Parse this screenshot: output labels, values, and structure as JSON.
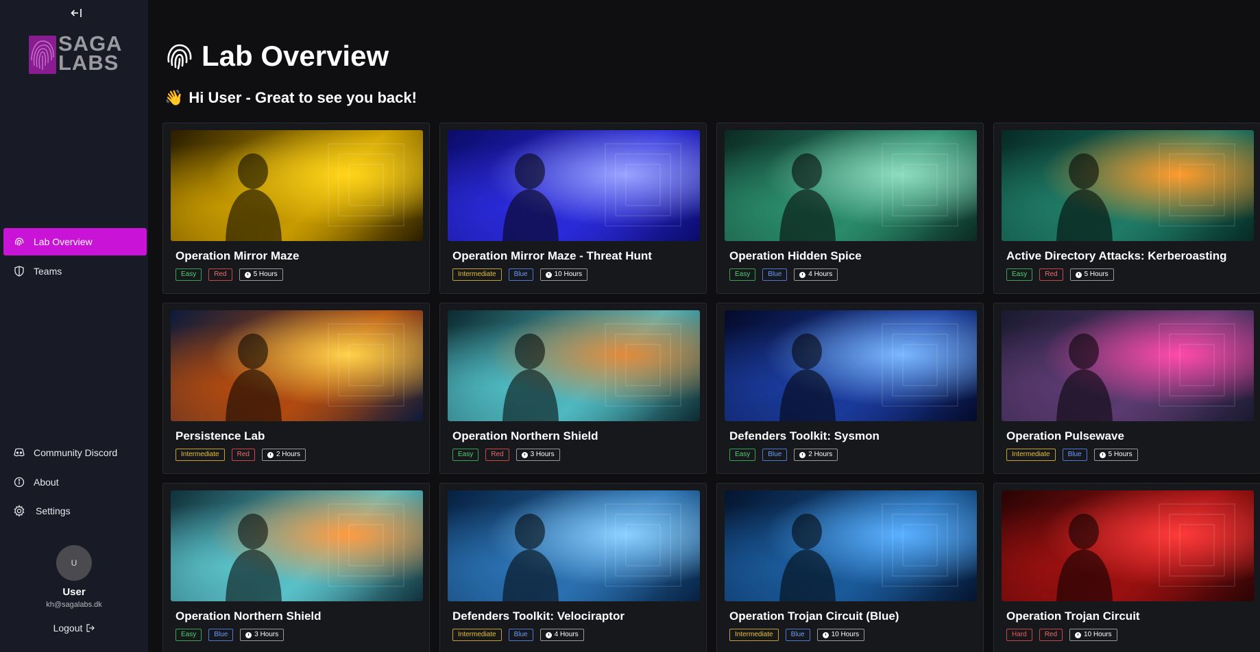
{
  "sidebar": {
    "logo_text_line1": "SAGA",
    "logo_text_line2": "LABS",
    "nav": [
      {
        "label": "Lab Overview",
        "icon": "fingerprint-icon",
        "active": true
      },
      {
        "label": "Teams",
        "icon": "shield-icon",
        "active": false
      }
    ],
    "bottom_nav": [
      {
        "label": "Community Discord",
        "icon": "discord-icon"
      },
      {
        "label": "About",
        "icon": "info-icon"
      },
      {
        "label": "Settings",
        "icon": "gear-icon"
      }
    ],
    "user": {
      "initial": "U",
      "name": "User",
      "email": "kh@sagalabs.dk",
      "logout_label": "Logout"
    }
  },
  "main": {
    "title": "Lab Overview",
    "greeting_emoji": "👋",
    "greeting": "Hi User - Great to see you back!"
  },
  "labs": [
    {
      "title": "Operation Mirror Maze",
      "difficulty": "Easy",
      "team": "Red",
      "duration": "5 Hours",
      "palette": [
        "#2a1d00",
        "#c79a00",
        "#ffd51a"
      ]
    },
    {
      "title": "Operation Mirror Maze - Threat Hunt",
      "difficulty": "Intermediate",
      "team": "Blue",
      "duration": "10 Hours",
      "palette": [
        "#0b0b6a",
        "#2a2ad8",
        "#9aa4ff"
      ]
    },
    {
      "title": "Operation Hidden Spice",
      "difficulty": "Easy",
      "team": "Blue",
      "duration": "4 Hours",
      "palette": [
        "#0b2a22",
        "#2a8a6a",
        "#8fdcc0"
      ]
    },
    {
      "title": "Active Directory Attacks: Kerberoasting",
      "difficulty": "Easy",
      "team": "Red",
      "duration": "5 Hours",
      "palette": [
        "#062a24",
        "#1f7a66",
        "#ff9a2a"
      ]
    },
    {
      "title": "Persistence Lab",
      "difficulty": "Intermediate",
      "team": "Red",
      "duration": "2 Hours",
      "palette": [
        "#0d1a3a",
        "#b04a10",
        "#ffd24a"
      ]
    },
    {
      "title": "Operation Northern Shield",
      "difficulty": "Easy",
      "team": "Red",
      "duration": "3 Hours",
      "palette": [
        "#0c2a30",
        "#4fb8c0",
        "#e28a3a"
      ]
    },
    {
      "title": "Defenders Toolkit: Sysmon",
      "difficulty": "Easy",
      "team": "Blue",
      "duration": "2 Hours",
      "palette": [
        "#040a2a",
        "#1a3a9a",
        "#7ab8ff"
      ]
    },
    {
      "title": "Operation Pulsewave",
      "difficulty": "Intermediate",
      "team": "Blue",
      "duration": "5 Hours",
      "palette": [
        "#1a1a30",
        "#5a3a70",
        "#ff4aa8"
      ]
    },
    {
      "title": "Operation Northern Shield",
      "difficulty": "Easy",
      "team": "Blue",
      "duration": "3 Hours",
      "palette": [
        "#10303a",
        "#5ac0c8",
        "#ff9a40"
      ]
    },
    {
      "title": "Defenders Toolkit: Velociraptor",
      "difficulty": "Intermediate",
      "team": "Blue",
      "duration": "4 Hours",
      "palette": [
        "#062040",
        "#2a70b0",
        "#8ad0ff"
      ]
    },
    {
      "title": "Operation Trojan Circuit (Blue)",
      "difficulty": "Intermediate",
      "team": "Blue",
      "duration": "10 Hours",
      "palette": [
        "#04142e",
        "#1a5a9a",
        "#5ab0ff"
      ]
    },
    {
      "title": "Operation Trojan Circuit",
      "difficulty": "Hard",
      "team": "Red",
      "duration": "10 Hours",
      "palette": [
        "#2a0404",
        "#9a1010",
        "#ff3a3a"
      ]
    }
  ]
}
